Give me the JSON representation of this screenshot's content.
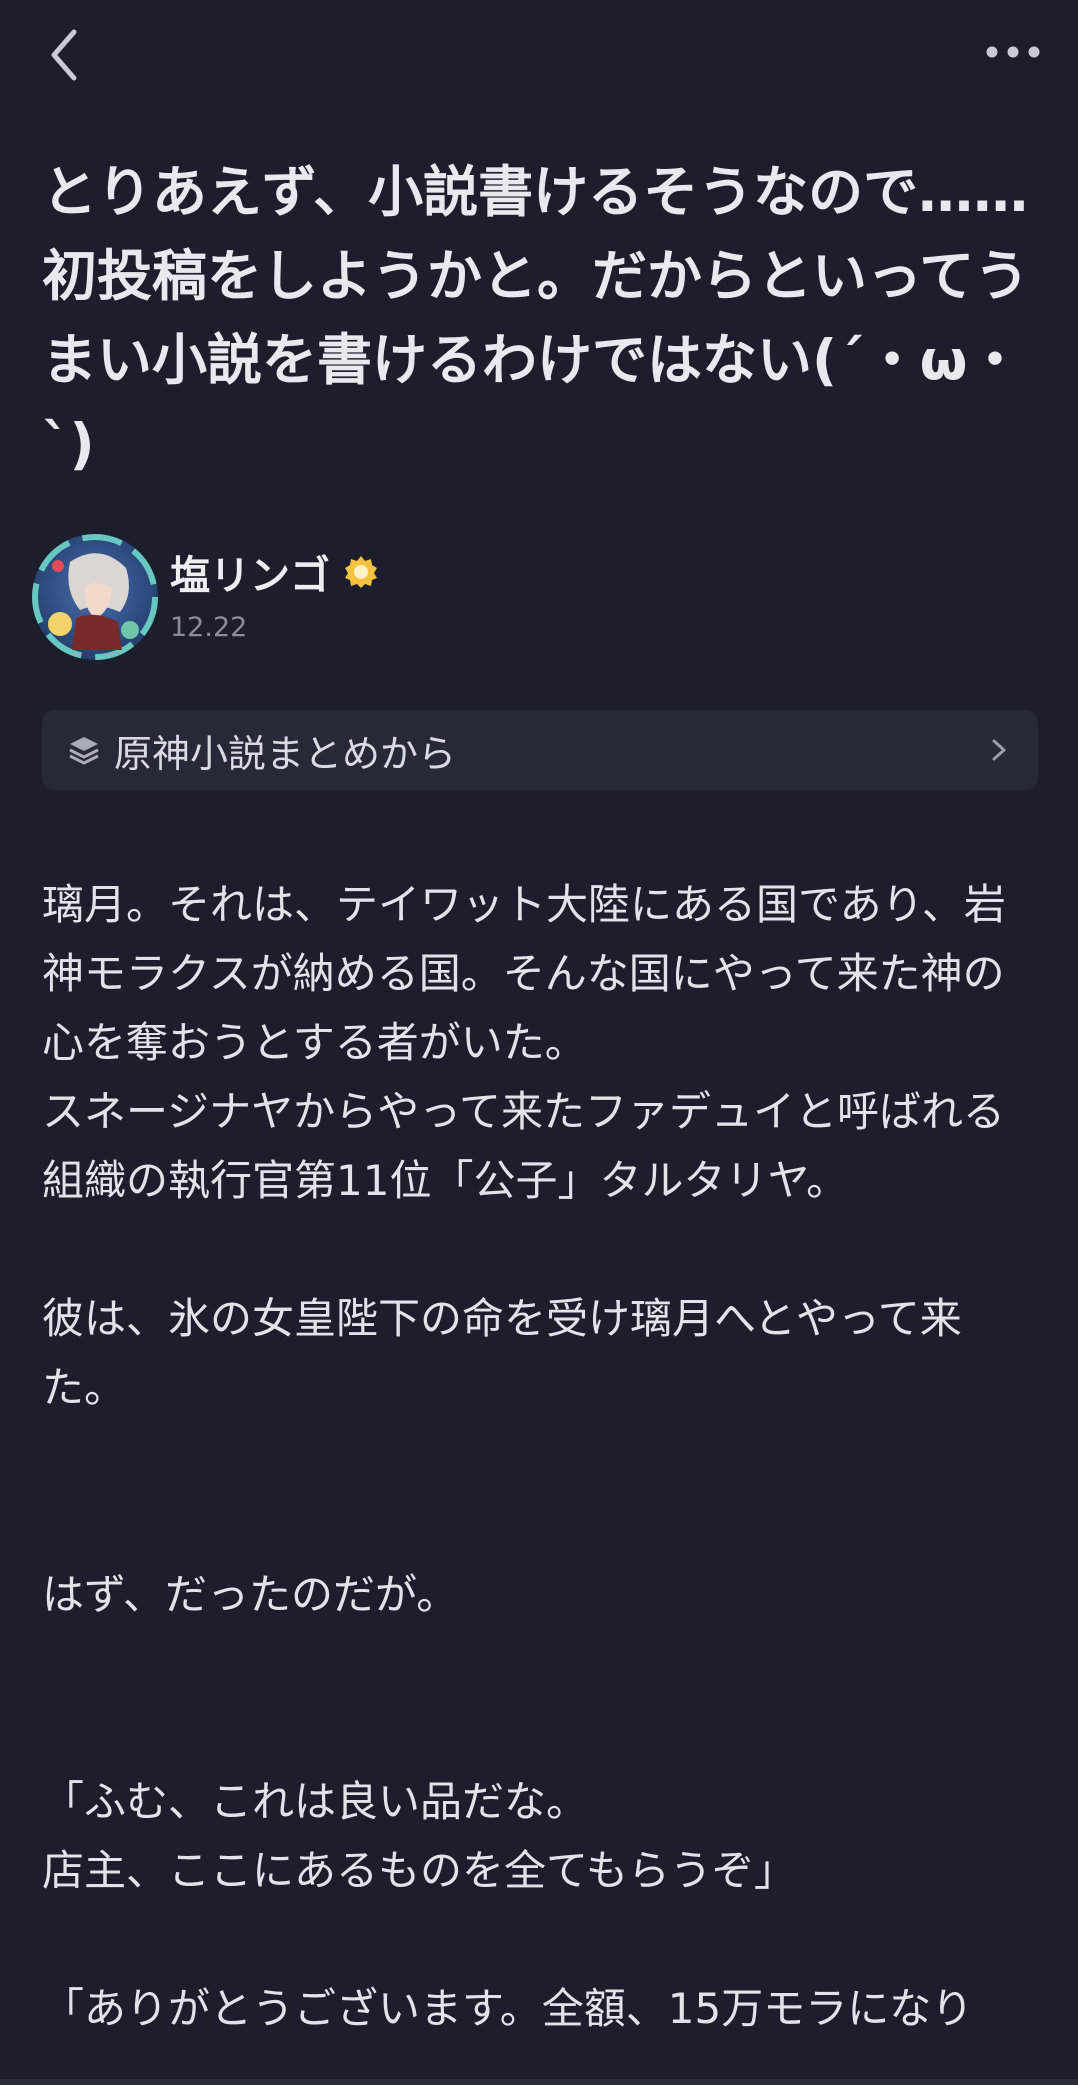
{
  "header": {
    "back_icon": "chevron-left-icon",
    "more_icon": "more-dots-icon"
  },
  "post": {
    "title": "とりあえず、小説書けるそうなので……初投稿をしようかと。だからといってうまい小説を書けるわけではない(´・ω・`)",
    "author": {
      "name": "塩リンゴ",
      "badge_icon": "verified-badge-icon",
      "avatar_icon": "avatar-image"
    },
    "date": "12.22",
    "collection": {
      "icon": "stack-layers-icon",
      "label": "原神小説まとめから"
    },
    "body": [
      "璃月。それは、テイワット大陸にある国であり、岩神モラクスが納める国。そんな国にやって来た神の心を奪おうとする者がいた。\nスネージナヤからやって来たファデュイと呼ばれる組織の執行官第11位「公子」タルタリヤ。",
      "",
      "彼は、氷の女皇陛下の命を受け璃月へとやって来た。",
      "",
      "",
      "はず、だったのだが。",
      "",
      "",
      "「ふむ、これは良い品だな。\n店主、ここにあるものを全てもらうぞ」",
      "",
      "「ありがとうございます。全額、15万モラになり"
    ]
  },
  "colors": {
    "background": "#1c1e2b",
    "card": "#262938",
    "text": "#e2e3e9",
    "muted": "#8a8d9c",
    "badge": "#f5c242"
  }
}
